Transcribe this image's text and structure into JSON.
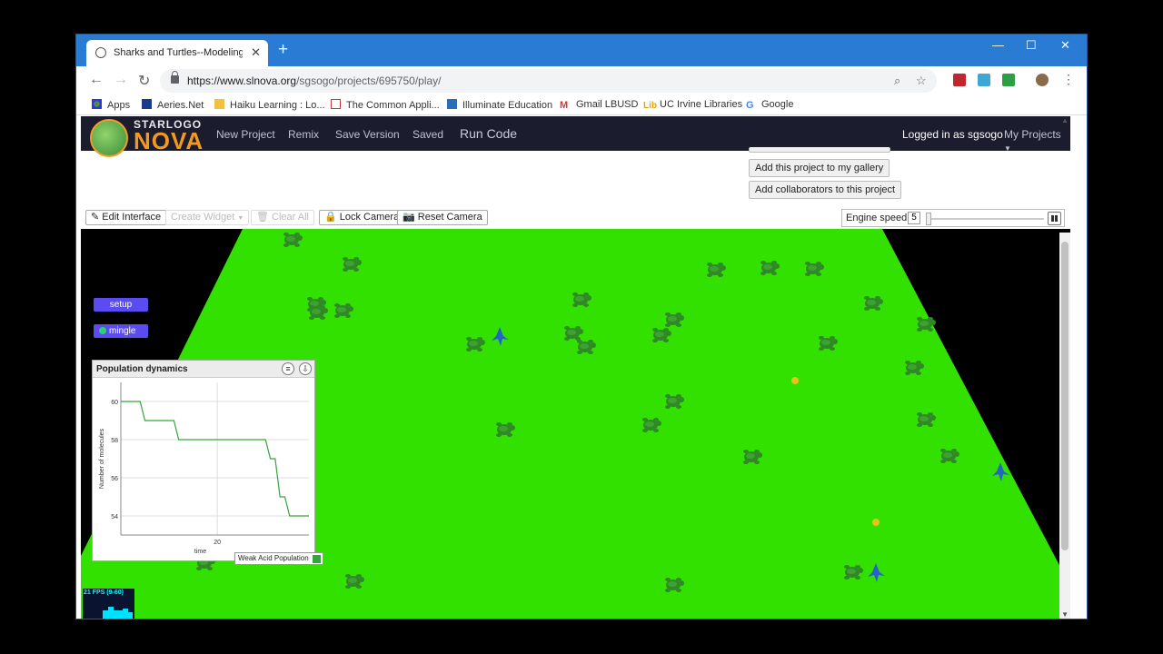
{
  "browser": {
    "tab_title": "Sharks and Turtles--Modeling W...",
    "url_domain": "https://www.slnova.org",
    "url_path": "/sgsogo/projects/695750/play/",
    "bookmarks": [
      "Apps",
      "Aeries.Net",
      "Haiku Learning : Lo...",
      "The Common Appli...",
      "Illuminate Education",
      "Gmail LBUSD",
      "UC Irvine Libraries",
      "Google"
    ]
  },
  "app": {
    "logo_top": "STARLOGO",
    "logo_bottom": "NOVA",
    "nav": [
      "New Project",
      "Remix",
      "Save Version",
      "Saved",
      "Run Code"
    ],
    "logged_in": "Logged in as sgsogo",
    "my_projects": "My Projects"
  },
  "project_buttons": [
    "Add this project to my gallery",
    "Add collaborators to this project"
  ],
  "toolbar": {
    "edit_interface": "Edit Interface",
    "create_widget": "Create Widget",
    "clear_all": "Clear All",
    "lock_camera": "Lock Camera",
    "reset_camera": "Reset Camera"
  },
  "engine": {
    "label": "Engine speed",
    "value": "5"
  },
  "widgets": {
    "setup": "setup",
    "mingle": "mingle"
  },
  "fps": "21 FPS (9-60)",
  "colors": {
    "terrain": "#33e100",
    "turtle": "#2f8a26",
    "shark": "#2563c9",
    "widget": "#5a4cf0",
    "series": "#34a43c"
  },
  "chart_data": {
    "type": "line",
    "title": "Population dynamics",
    "xlabel": "time",
    "ylabel": "Number of molecules",
    "x_ticks": [
      20
    ],
    "y_ticks": [
      54,
      56,
      58,
      60
    ],
    "xlim": [
      0,
      39
    ],
    "ylim": [
      53,
      61
    ],
    "series": [
      {
        "name": "Weak Acid Population",
        "x": [
          0,
          4,
          5,
          11,
          12,
          30,
          31,
          32,
          33,
          34,
          35,
          39
        ],
        "y": [
          60,
          60,
          59,
          59,
          58,
          58,
          57,
          57,
          55,
          55,
          54,
          54
        ]
      }
    ]
  }
}
